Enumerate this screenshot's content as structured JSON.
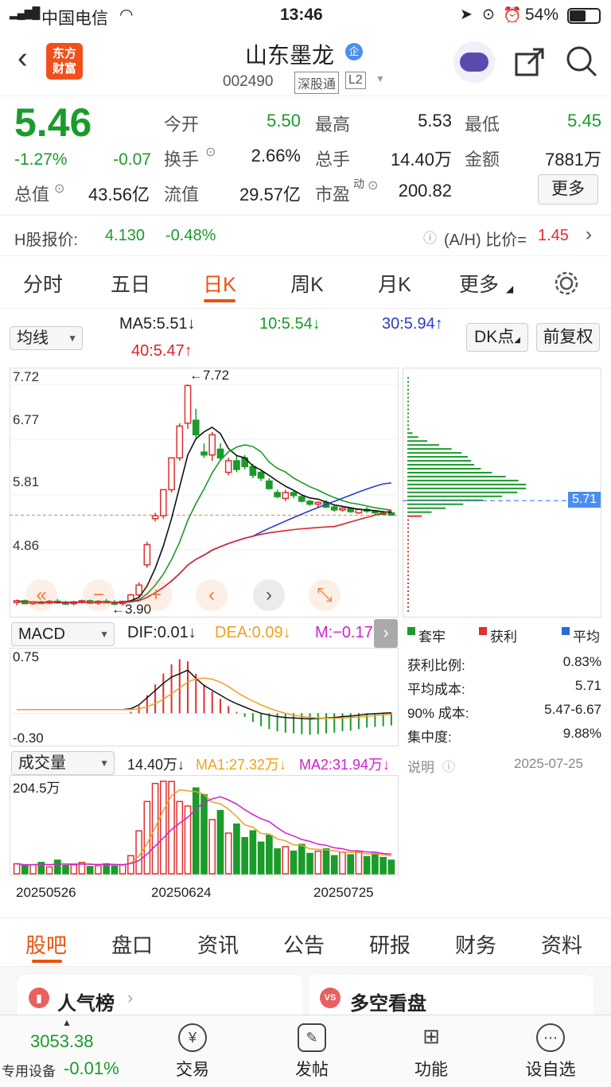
{
  "status": {
    "carrier": "中国电信",
    "time": "13:46",
    "battery": "54%"
  },
  "nav": {
    "logo_line1": "东方",
    "logo_line2": "财富",
    "title": "山东墨龙",
    "badge": "企",
    "code": "002490",
    "market": "深股通",
    "level": "L2"
  },
  "quote": {
    "price": "5.46",
    "change_pct": "-1.27%",
    "change": "-0.07",
    "open_label": "今开",
    "open": "5.50",
    "high_label": "最高",
    "high": "5.53",
    "low_label": "最低",
    "low": "5.45",
    "turnover_label": "换手",
    "turnover": "2.66%",
    "volume_label": "总手",
    "volume": "14.40万",
    "amount_label": "金额",
    "amount": "7881万",
    "mktcap_label": "总值",
    "mktcap": "43.56亿",
    "float_label": "流值",
    "float": "29.57亿",
    "pe_label": "市盈",
    "pe_sup": "动",
    "pe": "200.82",
    "more": "更多"
  },
  "hshare": {
    "label": "H股报价:",
    "price": "4.130",
    "change": "-0.48%",
    "ah_label": "(A/H) 比价=",
    "ah": "1.45"
  },
  "ktabs": [
    "分时",
    "五日",
    "日K",
    "周K",
    "月K",
    "更多"
  ],
  "ktab_selected": 2,
  "ma": {
    "select": "均线",
    "ma5": "MA5:5.51↓",
    "ma10": "10:5.54↓",
    "ma30": "30:5.94↑",
    "ma40": "40:5.47↑",
    "dk": "DK点",
    "fq": "前复权"
  },
  "price_axis": {
    "t1": "7.72",
    "t2": "6.77",
    "t3": "5.81",
    "t4": "4.86",
    "max_label": "7.72",
    "min_label": "3.90"
  },
  "chip": {
    "price_tag": "5.71",
    "legend": [
      "套牢",
      "获利",
      "平均"
    ],
    "rows": [
      {
        "k": "获利比例:",
        "v": "0.83%"
      },
      {
        "k": "平均成本:",
        "v": "5.71"
      },
      {
        "k": "90% 成本:",
        "v": "5.47-6.67"
      },
      {
        "k": "集中度:",
        "v": "9.88%"
      }
    ],
    "note": "说明",
    "date": "2025-07-25"
  },
  "macd": {
    "select": "MACD",
    "dif": "DIF:0.01↓",
    "dea": "DEA:0.09↓",
    "m": "M:−0.17",
    "top": "0.75",
    "bottom": "-0.30"
  },
  "vol": {
    "select": "成交量",
    "v": "14.40万↓",
    "ma1": "MA1:27.32万↓",
    "ma2": "MA2:31.94万↓",
    "top": "204.5万"
  },
  "dates": [
    "20250526",
    "20250624",
    "20250725"
  ],
  "btabs": [
    "股吧",
    "盘口",
    "资讯",
    "公告",
    "研报",
    "财务",
    "资料"
  ],
  "cards": [
    "人气榜",
    "多空看盘"
  ],
  "bottom": {
    "index": "3053.38",
    "device": "专用设备",
    "index_chg": "-0.01%",
    "items": [
      "交易",
      "发帖",
      "功能",
      "设自选"
    ]
  },
  "chart_data": {
    "type": "candlestick",
    "ohlc": [
      [
        3.95,
        4.0,
        3.9,
        3.98
      ],
      [
        3.98,
        4.0,
        3.92,
        3.93
      ],
      [
        3.93,
        3.97,
        3.91,
        3.96
      ],
      [
        3.96,
        3.98,
        3.92,
        3.94
      ],
      [
        3.94,
        3.99,
        3.92,
        3.97
      ],
      [
        3.97,
        4.01,
        3.93,
        3.95
      ],
      [
        3.95,
        3.98,
        3.91,
        3.93
      ],
      [
        3.93,
        3.98,
        3.9,
        3.96
      ],
      [
        3.96,
        4.0,
        3.93,
        3.98
      ],
      [
        3.98,
        4.0,
        3.92,
        3.94
      ],
      [
        3.94,
        3.99,
        3.91,
        3.97
      ],
      [
        3.97,
        4.01,
        3.94,
        3.95
      ],
      [
        3.95,
        3.99,
        3.9,
        3.93
      ],
      [
        3.93,
        3.98,
        3.9,
        3.97
      ],
      [
        3.97,
        4.1,
        3.95,
        4.08
      ],
      [
        4.08,
        4.3,
        4.05,
        4.25
      ],
      [
        4.6,
        5.0,
        4.55,
        4.95
      ],
      [
        5.4,
        5.5,
        5.35,
        5.45
      ],
      [
        5.45,
        5.9,
        5.4,
        5.9
      ],
      [
        5.9,
        6.45,
        5.85,
        6.45
      ],
      [
        6.45,
        7.05,
        6.4,
        7.0
      ],
      [
        7.05,
        7.72,
        6.95,
        7.7
      ],
      [
        7.1,
        7.3,
        6.8,
        6.85
      ],
      [
        6.55,
        6.7,
        6.45,
        6.5
      ],
      [
        6.5,
        6.9,
        6.4,
        6.85
      ],
      [
        6.6,
        6.7,
        6.4,
        6.45
      ],
      [
        6.2,
        6.45,
        6.15,
        6.4
      ],
      [
        6.4,
        6.5,
        6.2,
        6.25
      ],
      [
        6.45,
        6.5,
        6.25,
        6.3
      ],
      [
        6.3,
        6.35,
        6.1,
        6.15
      ],
      [
        6.2,
        6.25,
        6.05,
        6.1
      ],
      [
        6.05,
        6.1,
        5.9,
        5.92
      ],
      [
        5.85,
        5.9,
        5.75,
        5.78
      ],
      [
        5.75,
        5.9,
        5.7,
        5.85
      ],
      [
        5.85,
        5.88,
        5.75,
        5.8
      ],
      [
        5.78,
        5.82,
        5.68,
        5.7
      ],
      [
        5.7,
        5.72,
        5.62,
        5.65
      ],
      [
        5.65,
        5.7,
        5.6,
        5.68
      ],
      [
        5.68,
        5.72,
        5.58,
        5.6
      ],
      [
        5.6,
        5.63,
        5.52,
        5.55
      ],
      [
        5.55,
        5.6,
        5.52,
        5.58
      ],
      [
        5.58,
        5.6,
        5.5,
        5.52
      ],
      [
        5.5,
        5.58,
        5.48,
        5.56
      ],
      [
        5.56,
        5.6,
        5.5,
        5.53
      ],
      [
        5.53,
        5.55,
        5.47,
        5.5
      ],
      [
        5.5,
        5.53,
        5.46,
        5.48
      ],
      [
        5.5,
        5.53,
        5.45,
        5.46
      ]
    ],
    "ylim": [
      3.8,
      7.9
    ],
    "volume": [
      22,
      18,
      20,
      25,
      15,
      30,
      18,
      20,
      25,
      16,
      18,
      22,
      17,
      20,
      40,
      95,
      160,
      200,
      205,
      204.5,
      160,
      150,
      190,
      175,
      120,
      140,
      90,
      110,
      80,
      95,
      70,
      85,
      55,
      60,
      50,
      65,
      45,
      50,
      55,
      40,
      48,
      42,
      50,
      38,
      45,
      36,
      30
    ],
    "vol_max": 204.5,
    "macd_hist": [
      0,
      0,
      0,
      0,
      0,
      0,
      0,
      0,
      0,
      0,
      0,
      0,
      0,
      0,
      0.02,
      0.1,
      0.25,
      0.4,
      0.55,
      0.68,
      0.75,
      0.72,
      0.55,
      0.4,
      0.3,
      0.2,
      0.1,
      0.02,
      -0.05,
      -0.12,
      -0.18,
      -0.22,
      -0.25,
      -0.27,
      -0.28,
      -0.29,
      -0.3,
      -0.29,
      -0.28,
      -0.27,
      -0.25,
      -0.24,
      -0.22,
      -0.2,
      -0.19,
      -0.18,
      -0.17
    ]
  }
}
